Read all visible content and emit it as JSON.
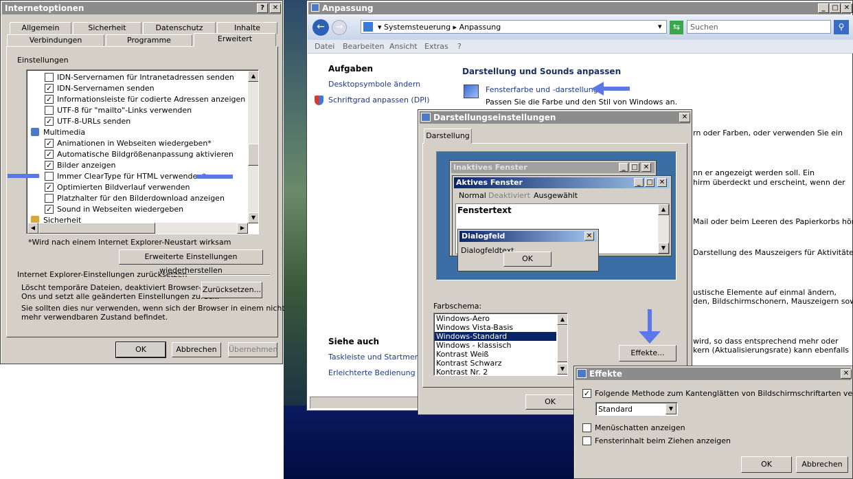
{
  "io": {
    "title": "Internetoptionen",
    "tabs_row1": [
      "Allgemein",
      "Sicherheit",
      "Datenschutz",
      "Inhalte"
    ],
    "tabs_row2": [
      "Verbindungen",
      "Programme",
      "Erweitert"
    ],
    "settings_label": "Einstellungen",
    "items": [
      {
        "label": "IDN-Servernamen für Intranetadressen senden",
        "checked": false
      },
      {
        "label": "IDN-Servernamen senden",
        "checked": true
      },
      {
        "label": "Informationsleiste für codierte Adressen anzeigen",
        "checked": true
      },
      {
        "label": "UTF-8 für \"mailto\"-Links verwenden",
        "checked": false
      },
      {
        "label": "UTF-8-URLs senden",
        "checked": true
      },
      {
        "label": "Multimedia",
        "group": true
      },
      {
        "label": "Animationen in Webseiten wiedergeben*",
        "checked": true
      },
      {
        "label": "Automatische Bildgrößenanpassung aktivieren",
        "checked": true
      },
      {
        "label": "Bilder anzeigen",
        "checked": true
      },
      {
        "label": "Immer ClearType für HTML verwenden*",
        "checked": false
      },
      {
        "label": "Optimierten Bildverlauf verwenden",
        "checked": true
      },
      {
        "label": "Platzhalter für den Bilderdownload anzeigen",
        "checked": false
      },
      {
        "label": "Sound in Webseiten wiedergeben",
        "checked": true
      },
      {
        "label": "Sicherheit",
        "group": true
      }
    ],
    "restart_note": "*Wird nach einem Internet Explorer-Neustart wirksam",
    "restore_button": "Erweiterte Einstellungen wiederherstellen",
    "reset_header": "Internet Explorer-Einstellungen zurücksetzen",
    "reset_text1": "Löscht temporäre Dateien, deaktiviert Browser-Add-",
    "reset_text2": "Ons und setzt alle geänderten Einstellungen zurück.",
    "reset_button": "Zurücksetzen...",
    "warn1": "Sie sollten dies nur verwenden, wenn sich der Browser in einem nicht",
    "warn2": "mehr verwendbaren Zustand befindet.",
    "ok": "OK",
    "cancel": "Abbrechen",
    "apply": "Übernehmen"
  },
  "an": {
    "title": "Anpassung",
    "breadcrumb1": "Systemsteuerung",
    "breadcrumb2": "Anpassung",
    "search_placeholder": "Suchen",
    "menu": [
      "Datei",
      "Bearbeiten",
      "Ansicht",
      "Extras",
      "?"
    ],
    "tasks_header": "Aufgaben",
    "task1": "Desktopsymbole ändern",
    "task2": "Schriftgrad anpassen (DPI)",
    "main_header": "Darstellung und Sounds anpassen",
    "item_title": "Fensterfarbe und -darstellung",
    "item_desc": "Passen Sie die Farbe und den Stil von Windows an.",
    "frag1": "rn oder Farben, oder verwenden Sie ein",
    "frag2": "nn er angezeigt werden soll. Ein",
    "frag3": "hirm überdeckt und erscheint, wenn der",
    "frag4": "Mail oder beim Leeren des Papierkorbs hören.",
    "frag5": "Darstellung des Mauszeigers für Aktivitäten,",
    "frag6": "ustische Elemente auf einmal ändern,",
    "frag7": "den, Bildschirmschonern, Mauszeigern sowie",
    "frag8": "wird, so dass entsprechend mehr oder",
    "frag9": "kern (Aktualisierungsrate) kann ebenfalls",
    "see_also": "Siehe auch",
    "see1": "Taskleiste und Startmenü",
    "see2": "Erleichterte Bedienung"
  },
  "ds": {
    "title": "Darstellungseinstellungen",
    "tab": "Darstellung",
    "inactive_title": "Inaktives Fenster",
    "active_title": "Aktives Fenster",
    "menu_normal": "Normal",
    "menu_disabled": "Deaktiviert",
    "menu_selected": "Ausgewählt",
    "window_text": "Fenstertext",
    "dialog_title": "Dialogfeld",
    "dialog_text": "Dialogfeldtext",
    "ok": "OK",
    "scheme_label": "Farbschema:",
    "schemes": [
      "Windows-Aero",
      "Windows Vista-Basis",
      "Windows-Standard",
      "Windows - klassisch",
      "Kontrast Weiß",
      "Kontrast Schwarz",
      "Kontrast Nr. 2"
    ],
    "selected_scheme": "Windows-Standard",
    "effects_button": "Effekte...",
    "ok2": "OK"
  },
  "ef": {
    "title": "Effekte",
    "smoothing_label": "Folgende Methode zum Kantenglätten von Bildschirmschriftarten verwenden:",
    "smoothing_value": "Standard",
    "menu_shadow": "Menüschatten anzeigen",
    "drag_content": "Fensterinhalt beim Ziehen anzeigen",
    "ok": "OK",
    "cancel": "Abbrechen"
  },
  "colors": {
    "accent_arrow": "#5a78e8",
    "selection": "#0a246a"
  }
}
